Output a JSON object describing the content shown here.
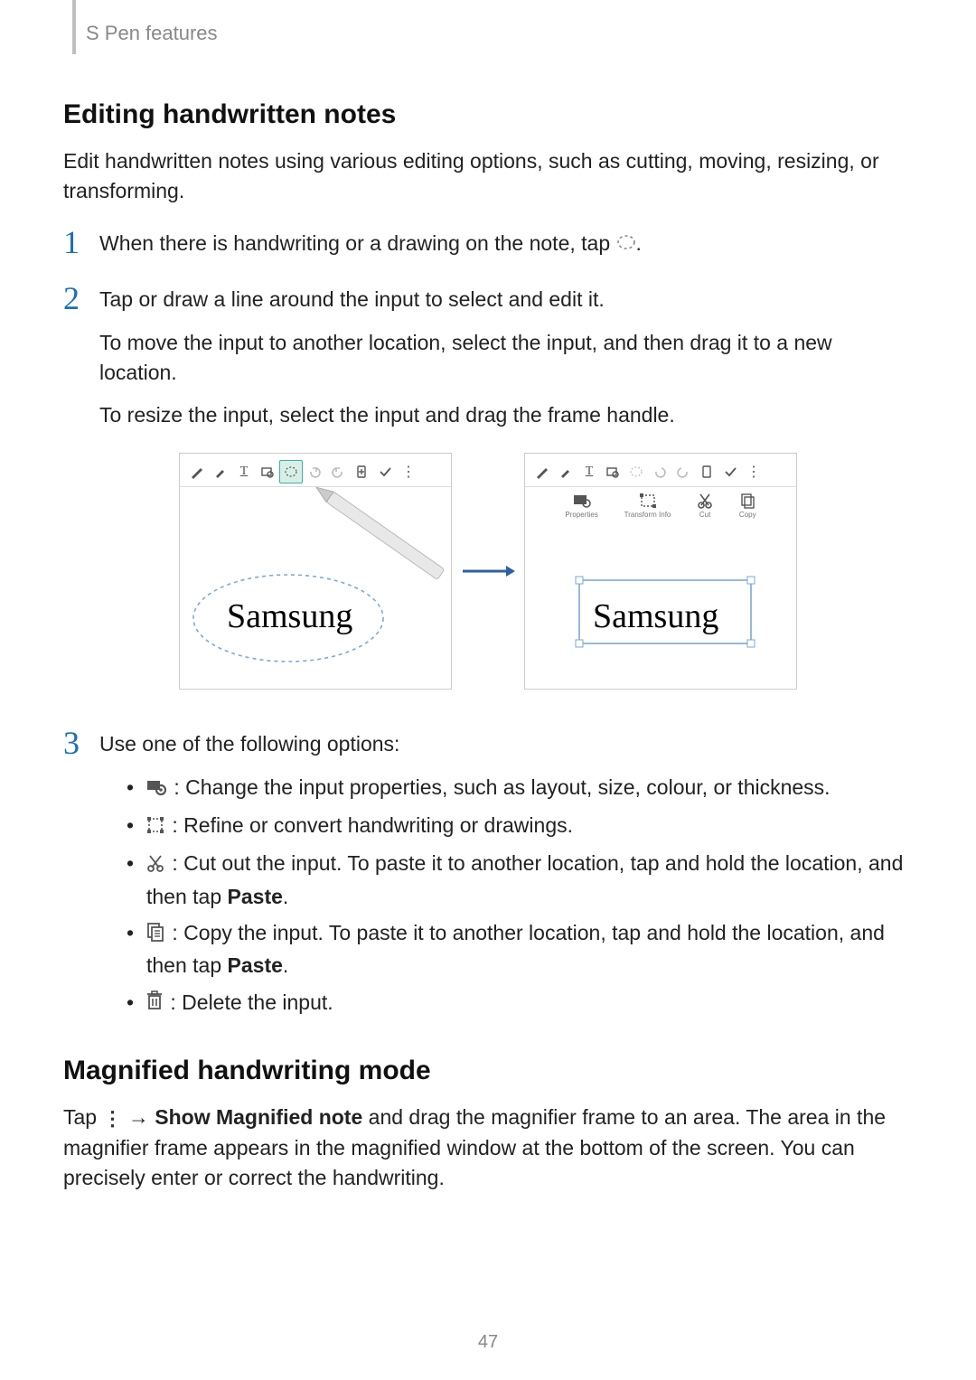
{
  "header": {
    "section": "S Pen features"
  },
  "page_number": "47",
  "editing": {
    "title": "Editing handwritten notes",
    "intro": "Edit handwritten notes using various editing options, such as cutting, moving, resizing, or transforming.",
    "step1_pre": "When there is handwriting or a drawing on the note, tap ",
    "step1_post": ".",
    "step2_line1": "Tap or draw a line around the input to select and edit it.",
    "step2_line2": "To move the input to another location, select the input, and then drag it to a new location.",
    "step2_line3": "To resize the input, select the input and drag the frame handle.",
    "step3_line1": "Use one of the following options:",
    "bullets": {
      "props": " : Change the input properties, such as layout, size, colour, or thickness.",
      "refine": " : Refine or convert handwriting or drawings.",
      "cut_pre": " : Cut out the input. To paste it to another location, tap and hold the location, and then tap ",
      "cut_bold": "Paste",
      "cut_post": ".",
      "copy_pre": " : Copy the input. To paste it to another location, tap and hold the location, and then tap ",
      "copy_bold": "Paste",
      "copy_post": ".",
      "delete": " : Delete the input."
    }
  },
  "magnified": {
    "title": "Magnified handwriting mode",
    "line_pre": "Tap ",
    "line_arrow": " → ",
    "line_bold": "Show Magnified note",
    "line_post": " and drag the magnifier frame to an area. The area in the magnifier frame appears in the magnified window at the bottom of the screen. You can precisely enter or correct the handwriting."
  },
  "illus": {
    "sample_text": "Samsung",
    "sub_labels": {
      "props": "Properties",
      "transform": "Transform Info",
      "cut": "Cut",
      "copy": "Copy"
    }
  }
}
